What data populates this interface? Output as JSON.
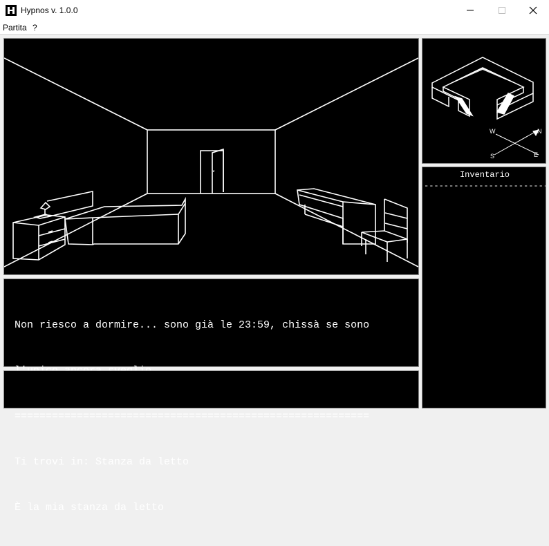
{
  "window": {
    "title": "Hypnos v. 1.0.0"
  },
  "menu": {
    "items": [
      "Partita",
      "?"
    ]
  },
  "narrative": {
    "lines": [
      "Non riesco a dormire... sono già le 23:59, chissà se sono",
      "l'unico ancora sveglio.",
      "=========================================================",
      "Ti trovi in: Stanza da letto",
      "È la mia stanza da letto"
    ]
  },
  "command": {
    "value": "",
    "placeholder": ""
  },
  "compass": {
    "n": "N",
    "e": "E",
    "s": "S",
    "w": "W"
  },
  "inventory": {
    "title": "Inventario",
    "separator": "--------------------------",
    "items": []
  },
  "icons": {
    "app": "hypnos-app-icon",
    "minimize": "minimize-icon",
    "maximize": "maximize-icon",
    "close": "close-icon"
  }
}
